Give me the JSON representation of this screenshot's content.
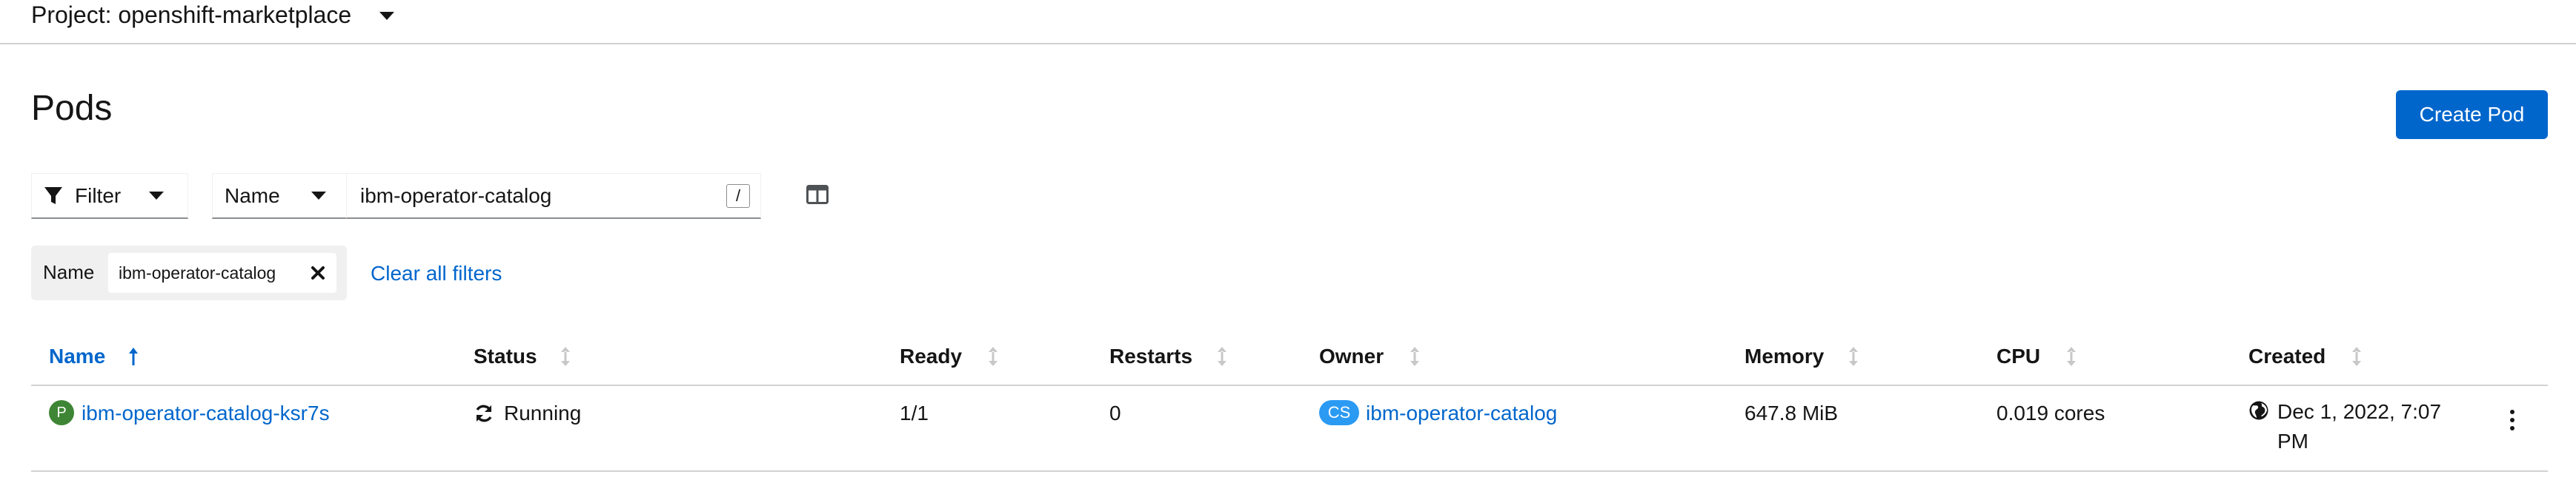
{
  "project": {
    "label": "Project: openshift-marketplace"
  },
  "page": {
    "title": "Pods",
    "create_button": "Create Pod"
  },
  "toolbar": {
    "filter_label": "Filter",
    "filter_type": "Name",
    "search_value": "ibm-operator-catalog",
    "shortcut_key": "/"
  },
  "active_filters": {
    "category": "Name",
    "chip": "ibm-operator-catalog",
    "clear_all": "Clear all filters"
  },
  "table": {
    "columns": [
      "Name",
      "Status",
      "Ready",
      "Restarts",
      "Owner",
      "Memory",
      "CPU",
      "Created"
    ],
    "rows": [
      {
        "name_badge": "P",
        "name": "ibm-operator-catalog-ksr7s",
        "status": "Running",
        "ready": "1/1",
        "restarts": "0",
        "owner_badge": "CS",
        "owner": "ibm-operator-catalog",
        "memory": "647.8 MiB",
        "cpu": "0.019 cores",
        "created_line1": "Dec 1, 2022, 7:07",
        "created_line2": "PM"
      }
    ]
  },
  "colors": {
    "link": "#0066cc",
    "primary_button": "#0066cc",
    "pod_badge": "#3e8635",
    "owner_badge": "#2b9af3"
  }
}
